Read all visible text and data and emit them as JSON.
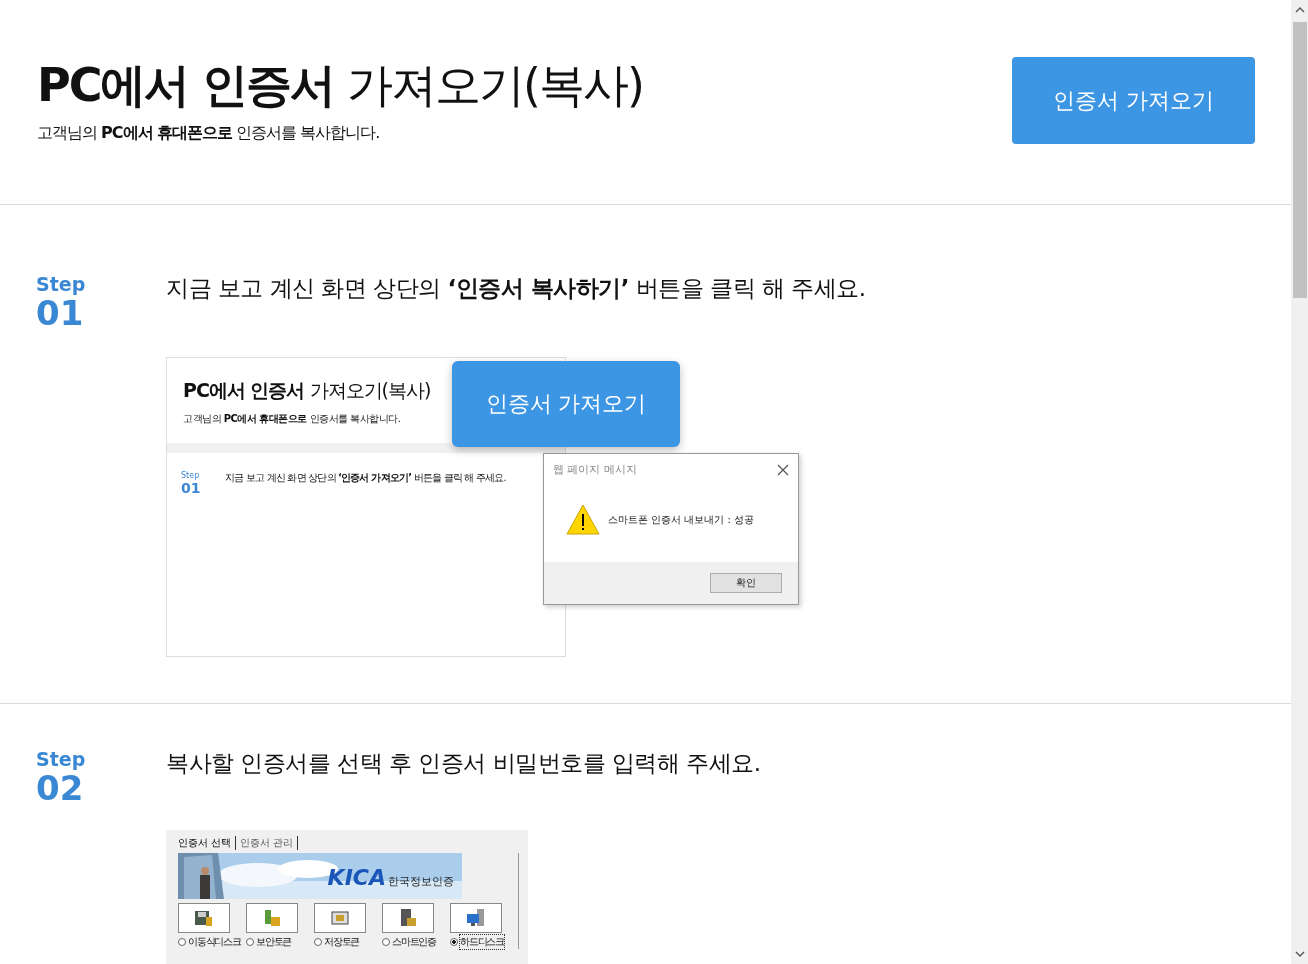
{
  "header": {
    "title": "**PC에서 인증서** 가져오기(복사)",
    "subtitle": "고객님의 **PC에서 휴대폰으로** 인증서를 복사합니다.",
    "button": "인증서 가져오기"
  },
  "steps": [
    {
      "label": "Step",
      "number": "01",
      "instruction": "지금 보고 계신 화면 상단의 **‘인증서 복사하기’** 버튼을 클릭 해 주세요.",
      "illustration": {
        "kind": "web-page",
        "title": "**PC에서 인증서** 가져오기(복사)",
        "subtitle": "고객님의 **PC에서 휴대폰으로** 인증서를 복사합니다.",
        "step_label": "Step",
        "step_number": "01",
        "instruction": "지금 보고 계신 화면 상단의 **‘인증서 가져오기’** 버튼을 클릭 해 주세요.",
        "button": "인증서 가져오기",
        "dialog": {
          "title": "웹 페이지 메시지",
          "message": "스마트폰 인증서 내보내기 : 성공",
          "ok": "확인"
        }
      }
    },
    {
      "label": "Step",
      "number": "02",
      "instruction": "복사할 인증서를 선택 후 인증서 비밀번호를 입력해 주세요.",
      "illustration": {
        "kind": "cert-dialog",
        "tabs": [
          {
            "label": "인증서 선택",
            "selected": true
          },
          {
            "label": "인증서 관리",
            "selected": false
          }
        ],
        "logo": "KICA",
        "brand": "한국정보인증",
        "media": [
          {
            "kind": "disk",
            "label": "이동식디스크",
            "selected": false
          },
          {
            "kind": "token",
            "label": "보안토큰",
            "selected": false
          },
          {
            "kind": "storage",
            "label": "저장토큰",
            "selected": false
          },
          {
            "kind": "phone",
            "label": "스마트인증",
            "selected": false
          },
          {
            "kind": "pc",
            "label": "하드디스크",
            "selected": true
          }
        ]
      }
    }
  ]
}
